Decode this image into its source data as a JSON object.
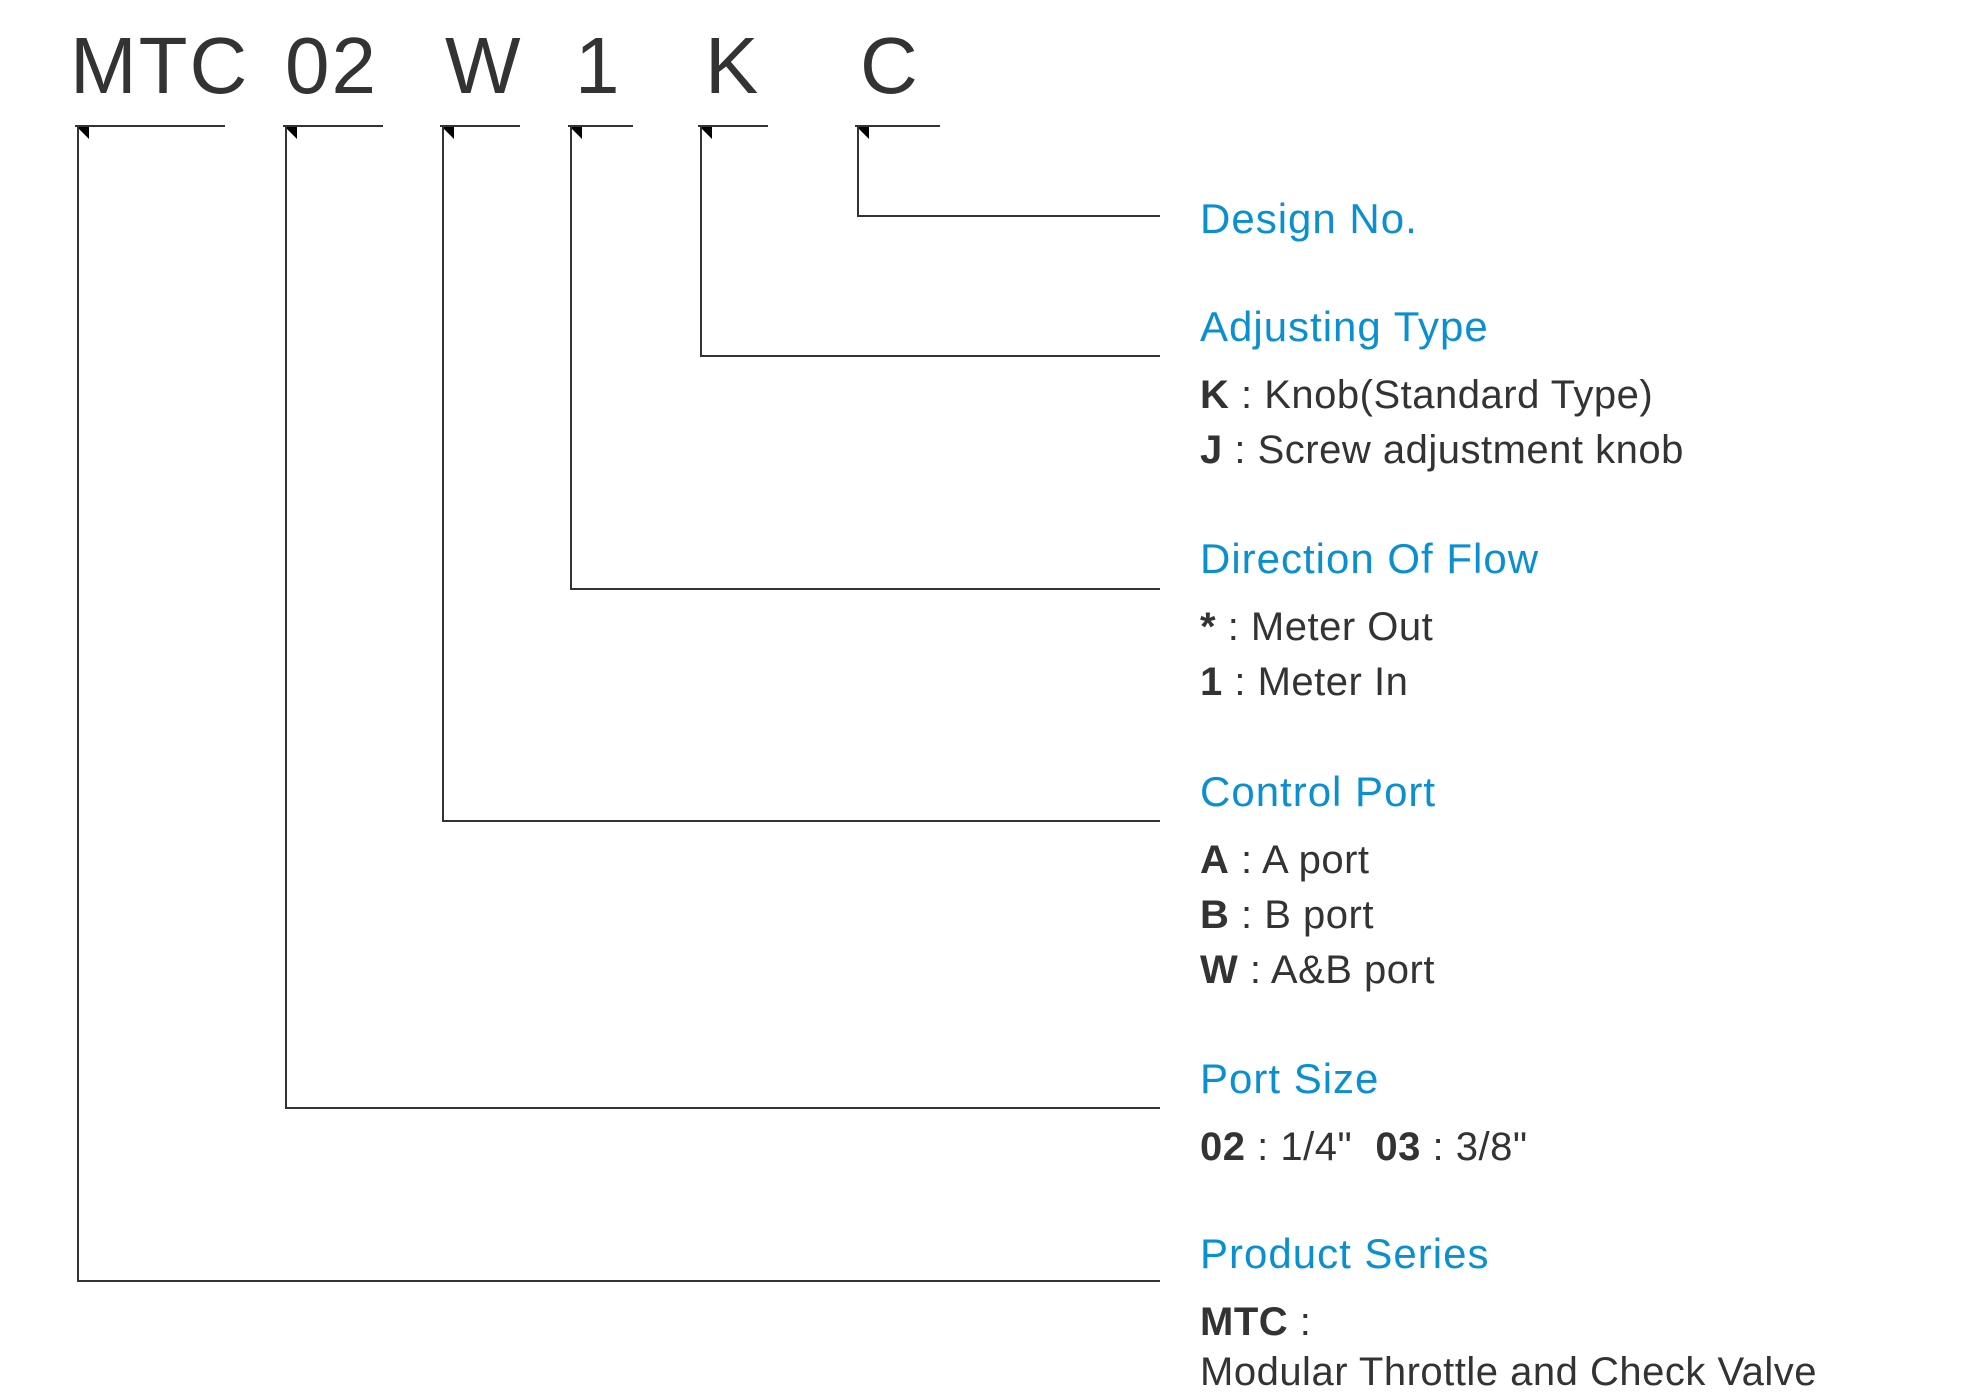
{
  "code_parts": {
    "p0": "MTC",
    "p1": "02",
    "p2": "W",
    "p3": "1",
    "p4": "K",
    "p5": "C"
  },
  "sections": {
    "design_no": {
      "title": "Design No."
    },
    "adjusting_type": {
      "title": "Adjusting Type",
      "opt_k_code": "K",
      "opt_k_sep": " : ",
      "opt_k_text": "Knob(Standard Type)",
      "opt_j_code": "J",
      "opt_j_sep": " : ",
      "opt_j_text": "Screw adjustment knob"
    },
    "direction_of_flow": {
      "title": "Direction Of Flow",
      "opt_star_code": "*",
      "opt_star_sep": " : ",
      "opt_star_text": "Meter Out",
      "opt_1_code": "1",
      "opt_1_sep": " : ",
      "opt_1_text": "Meter In"
    },
    "control_port": {
      "title": "Control Port",
      "opt_a_code": "A",
      "opt_a_sep": " : ",
      "opt_a_text": "A port",
      "opt_b_code": "B",
      "opt_b_sep": " : ",
      "opt_b_text": "B port",
      "opt_w_code": "W",
      "opt_w_sep": " : ",
      "opt_w_text": "A&B port"
    },
    "port_size": {
      "title": "Port Size",
      "opt_02_code": "02",
      "opt_02_sep": " : ",
      "opt_02_text": "1/4\"",
      "opt_03_code": "03",
      "opt_03_sep": " : ",
      "opt_03_text": "3/8\""
    },
    "product_series": {
      "title": "Product Series",
      "opt_mtc_code": "MTC",
      "opt_mtc_sep": " : ",
      "opt_mtc_text": "Modular Throttle and Check Valve"
    }
  },
  "chart_data": {
    "type": "table",
    "title": "Model Code Breakdown",
    "code_example": "MTC 02 W 1 K C",
    "fields": [
      {
        "position": 0,
        "sample": "MTC",
        "name": "Product Series",
        "options": [
          {
            "code": "MTC",
            "meaning": "Modular Throttle and Check Valve"
          }
        ]
      },
      {
        "position": 1,
        "sample": "02",
        "name": "Port Size",
        "options": [
          {
            "code": "02",
            "meaning": "1/4\""
          },
          {
            "code": "03",
            "meaning": "3/8\""
          }
        ]
      },
      {
        "position": 2,
        "sample": "W",
        "name": "Control Port",
        "options": [
          {
            "code": "A",
            "meaning": "A port"
          },
          {
            "code": "B",
            "meaning": "B port"
          },
          {
            "code": "W",
            "meaning": "A&B port"
          }
        ]
      },
      {
        "position": 3,
        "sample": "1",
        "name": "Direction Of Flow",
        "options": [
          {
            "code": "*",
            "meaning": "Meter Out"
          },
          {
            "code": "1",
            "meaning": "Meter In"
          }
        ]
      },
      {
        "position": 4,
        "sample": "K",
        "name": "Adjusting Type",
        "options": [
          {
            "code": "K",
            "meaning": "Knob(Standard Type)"
          },
          {
            "code": "J",
            "meaning": "Screw adjustment knob"
          }
        ]
      },
      {
        "position": 5,
        "sample": "C",
        "name": "Design No.",
        "options": []
      }
    ]
  }
}
